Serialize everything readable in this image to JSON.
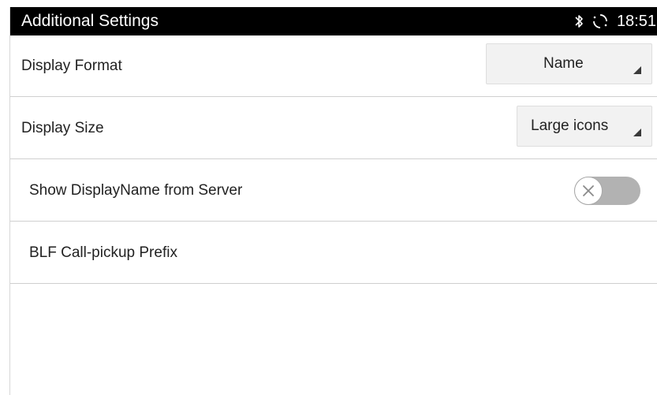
{
  "header": {
    "title": "Additional Settings",
    "time": "18:51",
    "status_icons": [
      "bluetooth-icon",
      "sync-icon"
    ]
  },
  "settings": {
    "display_format": {
      "label": "Display Format",
      "value": "Name"
    },
    "display_size": {
      "label": "Display Size",
      "value": "Large icons"
    },
    "show_display_name": {
      "label": "Show DisplayName from Server",
      "enabled": false
    },
    "blf_prefix": {
      "label": "BLF Call-pickup Prefix"
    }
  },
  "colors": {
    "statusbar_bg": "#000000",
    "toggle_off": "#b2b2b2",
    "dropdown_bg": "#f2f2f2"
  }
}
